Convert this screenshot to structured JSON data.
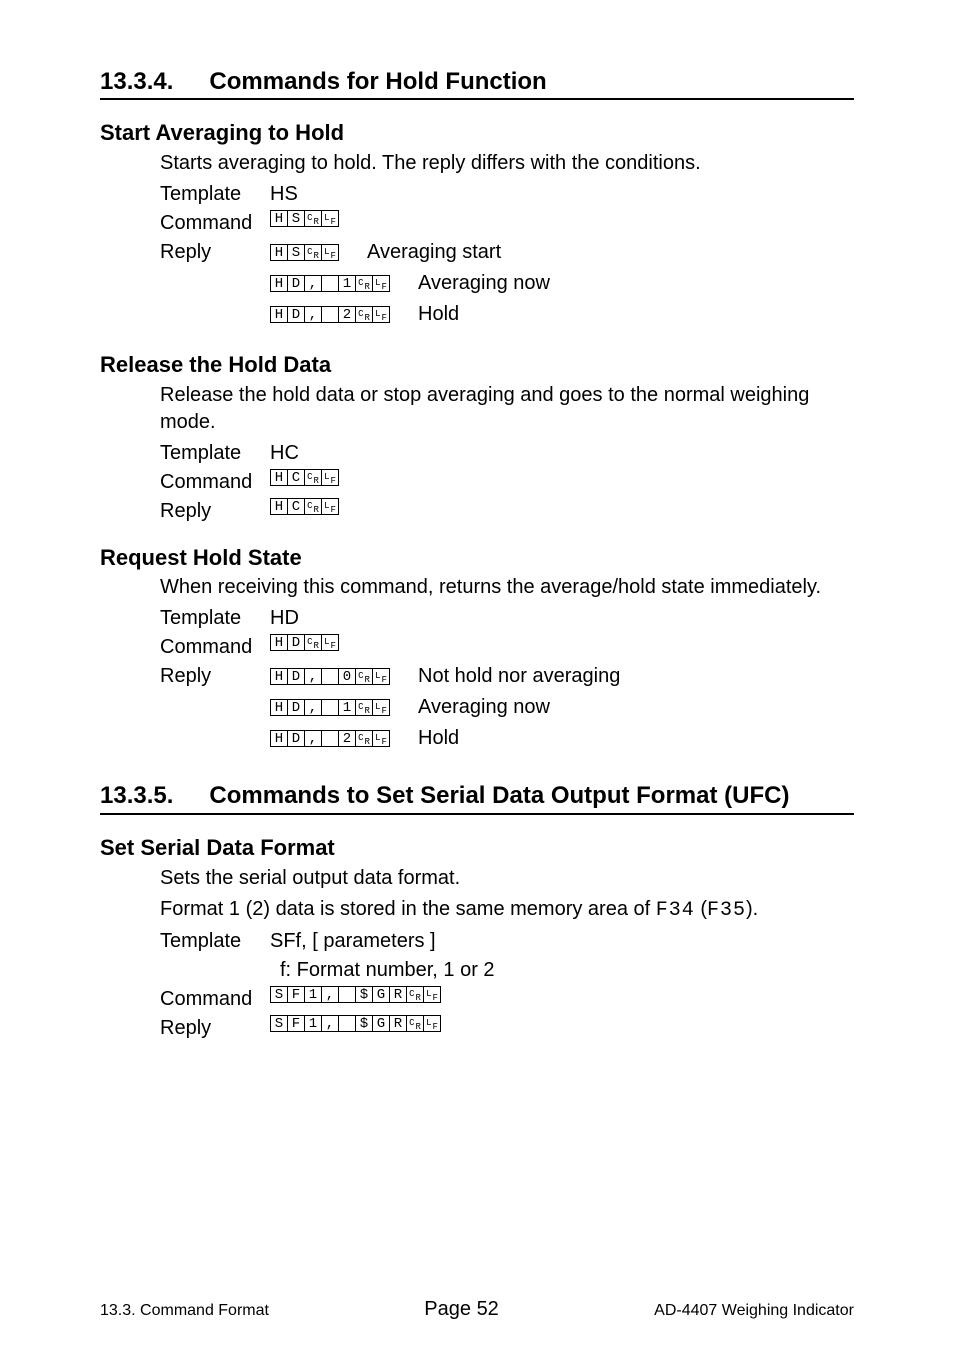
{
  "sec1": {
    "num": "13.3.4.",
    "title": "Commands for Hold Function",
    "sub1": {
      "heading": "Start Averaging to Hold",
      "desc": "Starts averaging to hold. The reply differs with the conditions.",
      "template_label": "Template",
      "template_value": "HS",
      "command_label": "Command",
      "reply_label": "Reply",
      "replies": {
        "r1_note": "Averaging start",
        "r2_note": "Averaging now",
        "r3_note": "Hold"
      }
    },
    "sub2": {
      "heading": "Release the Hold Data",
      "desc": "Release the hold data or stop averaging and goes to the normal weighing mode.",
      "template_label": "Template",
      "template_value": "HC",
      "command_label": "Command",
      "reply_label": "Reply"
    },
    "sub3": {
      "heading": "Request Hold State",
      "desc": "When receiving this command, returns the average/hold state immediately.",
      "template_label": "Template",
      "template_value": "HD",
      "command_label": "Command",
      "reply_label": "Reply",
      "replies": {
        "r1_note": "Not hold nor averaging",
        "r2_note": "Averaging now",
        "r3_note": "Hold"
      }
    }
  },
  "sec2": {
    "num": "13.3.5.",
    "title": "Commands to Set Serial Data Output Format (UFC)",
    "sub1": {
      "heading": "Set Serial Data Format",
      "desc": "Sets the serial output data format.",
      "desc2a": "Format 1 (2) data is stored in the same memory area of ",
      "desc2b": " (",
      "desc2c": ").",
      "f34": "F34",
      "f35": "F35",
      "template_label": "Template",
      "template_value": "SFf, [ parameters ]",
      "template_note": "f: Format number, 1 or 2",
      "command_label": "Command",
      "reply_label": "Reply"
    }
  },
  "commands": {
    "HS": [
      "H",
      "S",
      "CR",
      "LF"
    ],
    "HC": [
      "H",
      "C",
      "CR",
      "LF"
    ],
    "HD": [
      "H",
      "D",
      "CR",
      "LF"
    ],
    "HD0": [
      "H",
      "D",
      ",",
      "␣",
      "0",
      "CR",
      "LF"
    ],
    "HD1": [
      "H",
      "D",
      ",",
      "␣",
      "1",
      "CR",
      "LF"
    ],
    "HD2": [
      "H",
      "D",
      ",",
      "␣",
      "2",
      "CR",
      "LF"
    ],
    "SF1": [
      "S",
      "F",
      "1",
      ",",
      "␣",
      "$",
      "G",
      "R",
      "CR",
      "LF"
    ]
  },
  "footer": {
    "left": "13.3. Command Format",
    "mid": "Page 52",
    "right": "AD-4407 Weighing Indicator"
  }
}
